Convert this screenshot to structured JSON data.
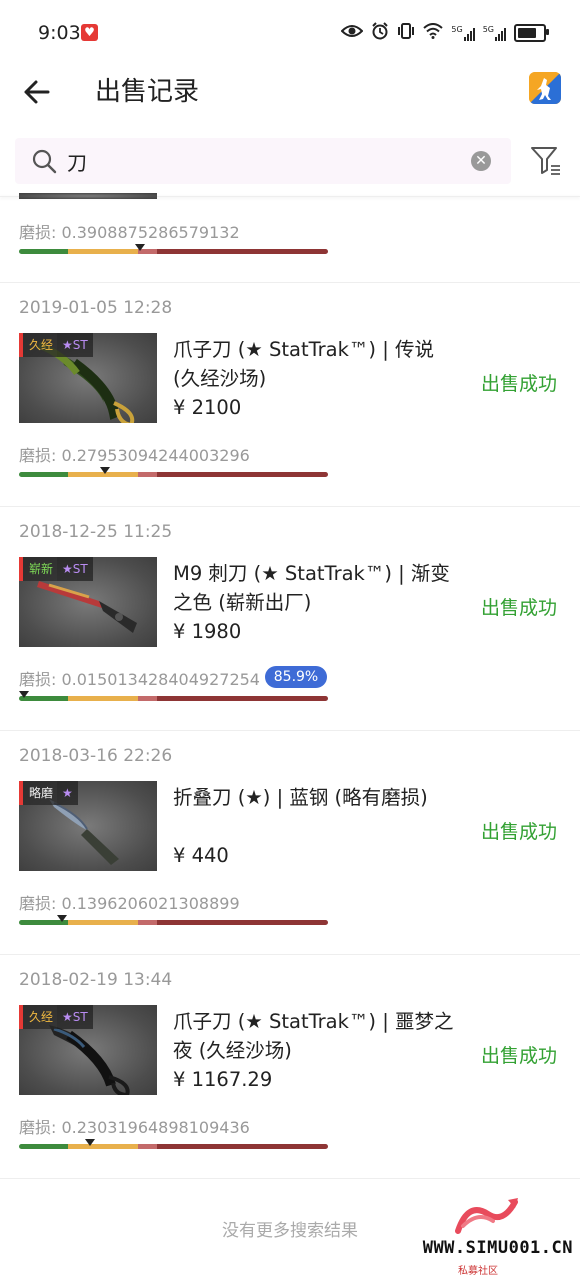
{
  "status_bar": {
    "time": "9:03",
    "net1": "5G",
    "net2": "5G"
  },
  "header": {
    "title": "出售记录",
    "back_icon": "arrow-left-icon",
    "app_icon": "cs-app-icon"
  },
  "search": {
    "value": "刀",
    "placeholder": ""
  },
  "top_partial": {
    "wear_label": "磨损: 0.3908875286579132",
    "marker_pos": 0.3908875286579132
  },
  "items": [
    {
      "date": "2019-01-05 12:28",
      "exterior": "久经",
      "st": "★ST",
      "name": "爪子刀 (★ StatTrak™) | 传说 (久经沙场)",
      "price": "¥ 2100",
      "status": "出售成功",
      "wear_label": "磨损: 0.27953094244003296",
      "marker_pos": 0.27953094244003296
    },
    {
      "date": "2018-12-25 11:25",
      "exterior": "崭新",
      "st": "★ST",
      "name": "M9 刺刀 (★ StatTrak™) | 渐变之色 (崭新出厂)",
      "price": "¥ 1980",
      "status": "出售成功",
      "wear_label": "磨损: 0.015013428404927254",
      "marker_pos": 0.015013428404927254,
      "percent_badge": "85.9%"
    },
    {
      "date": "2018-03-16 22:26",
      "exterior": "略磨",
      "st": "★",
      "name": "折叠刀 (★) | 蓝钢 (略有磨损)",
      "price": "¥ 440",
      "status": "出售成功",
      "wear_label": "磨损: 0.1396206021308899",
      "marker_pos": 0.1396206021308899
    },
    {
      "date": "2018-02-19 13:44",
      "exterior": "久经",
      "st": "★ST",
      "name": "爪子刀 (★ StatTrak™) | 噩梦之夜 (久经沙场)",
      "price": "¥ 1167.29",
      "status": "出售成功",
      "wear_label": "磨损: 0.23031964898109436",
      "marker_pos": 0.23031964898109436
    }
  ],
  "footer": {
    "no_more": "没有更多搜索结果"
  },
  "watermark": {
    "text": "WWW.SIMU001.CN",
    "sub": "私募社区"
  },
  "colors": {
    "success": "#33a133",
    "wear_green": "#3d8b3d",
    "wear_yellow": "#e8b04c",
    "wear_pink": "#c36a6a",
    "wear_red": "#8e3535",
    "badge_blue": "#3e6bd6",
    "exterior_red": "#e53935",
    "st_purple": "#b98cf2"
  }
}
